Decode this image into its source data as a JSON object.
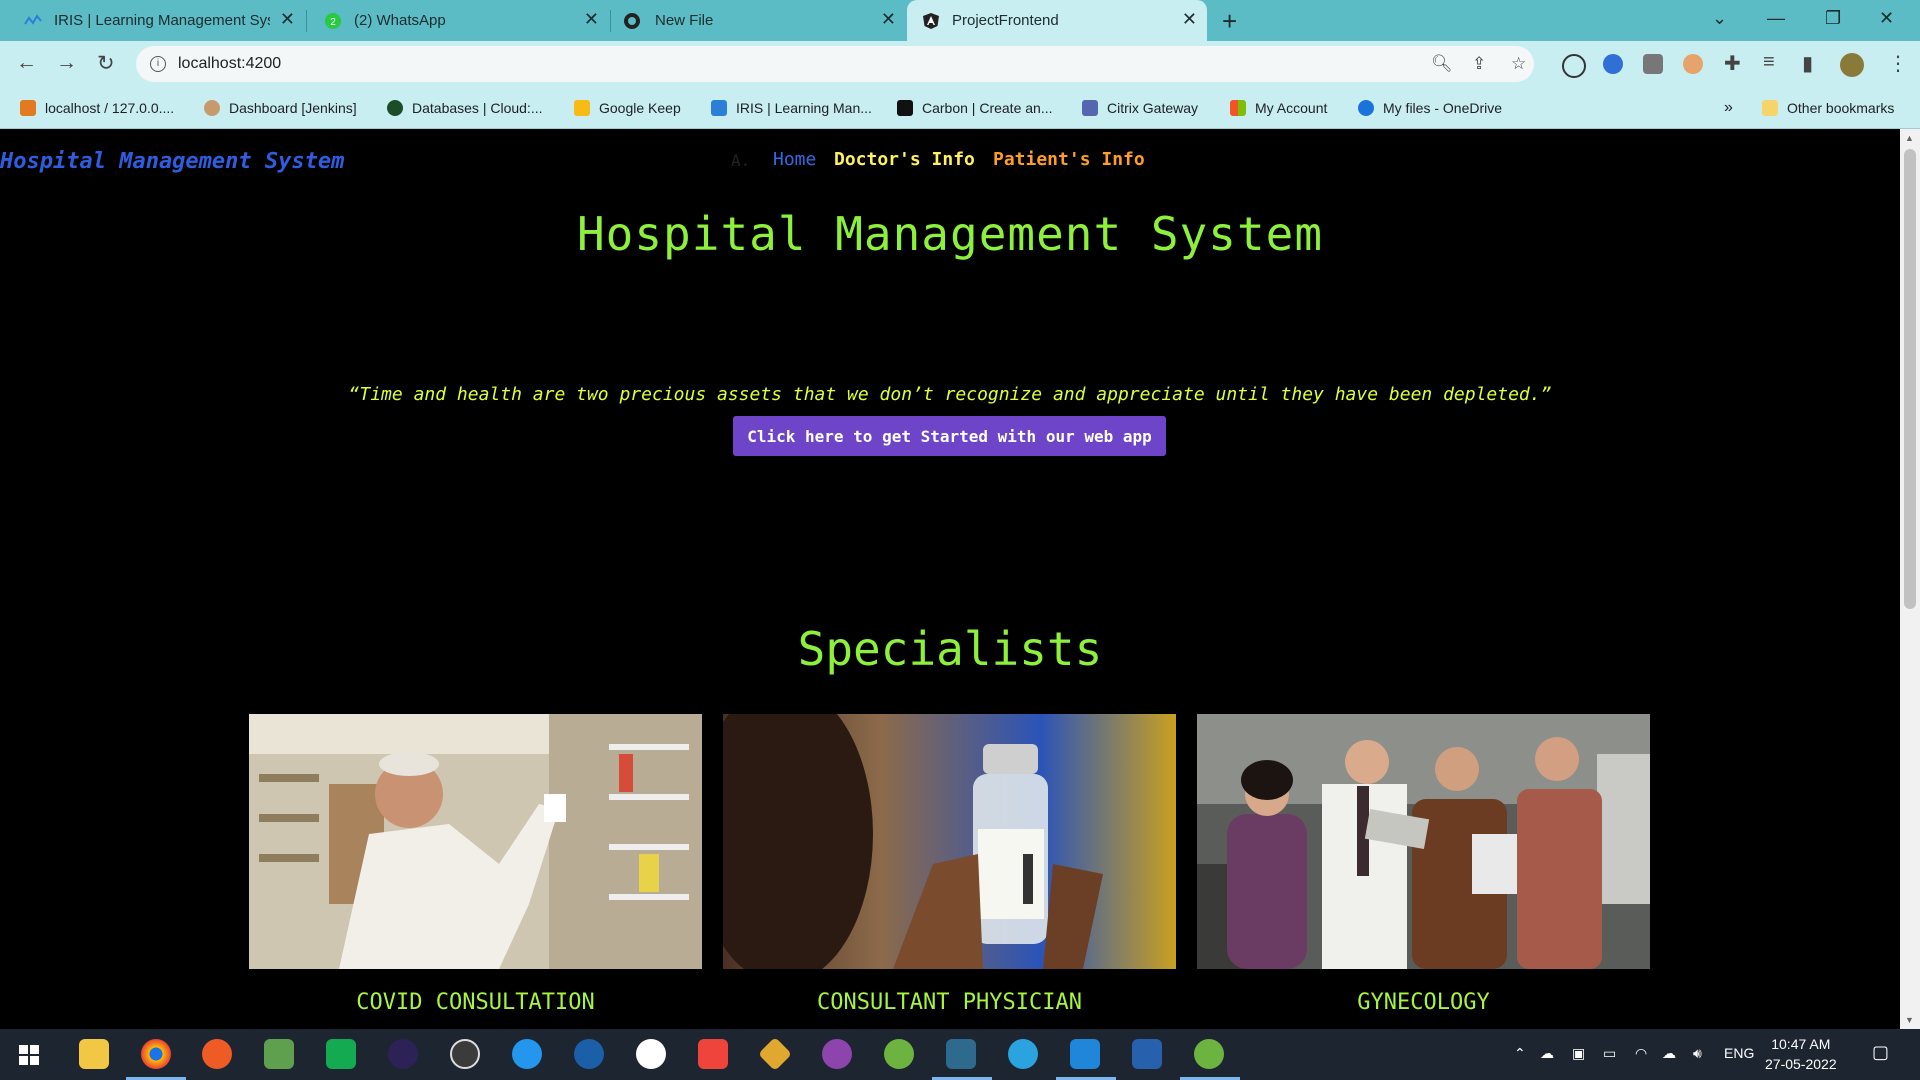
{
  "browser": {
    "tabs": [
      {
        "label": "IRIS | Learning Management Syst",
        "icon": "iris-icon",
        "active": false
      },
      {
        "label": "(2) WhatsApp",
        "icon": "whatsapp-icon",
        "active": false
      },
      {
        "label": "New File",
        "icon": "github-icon",
        "active": false
      },
      {
        "label": "ProjectFrontend",
        "icon": "angular-icon",
        "active": true
      }
    ],
    "new_tab_symbol": "+",
    "close_symbol": "✕",
    "url": "localhost:4200",
    "bookmarks": [
      {
        "label": "localhost / 127.0.0....",
        "icon": "phpmyadmin-icon",
        "color": "#e27b1f"
      },
      {
        "label": "Dashboard [Jenkins]",
        "icon": "jenkins-icon",
        "color": "#c79a6e"
      },
      {
        "label": "Databases | Cloud:...",
        "icon": "mongodb-icon",
        "color": "#1b4d28"
      },
      {
        "label": "Google Keep",
        "icon": "google-keep-icon",
        "color": "#f8bb16"
      },
      {
        "label": "IRIS | Learning Man...",
        "icon": "iris-icon",
        "color": "#2b7fd6"
      },
      {
        "label": "Carbon | Create an...",
        "icon": "carbon-icon",
        "color": "#111111"
      },
      {
        "label": "Citrix Gateway",
        "icon": "lock-icon",
        "color": "#5466b0"
      },
      {
        "label": "My Account",
        "icon": "microsoft-icon",
        "color": "#f35325"
      },
      {
        "label": "My files - OneDrive",
        "icon": "onedrive-icon",
        "color": "#1a73d9"
      }
    ],
    "more_bookmarks": "»",
    "other_bookmarks": "Other bookmarks"
  },
  "page": {
    "brand": "Hospital Management System",
    "nav": {
      "marker": "A.",
      "home": "Home",
      "doctors": "Doctor's Info",
      "patients": "Patient's Info"
    },
    "hero_title": "Hospital Management System",
    "quote": "“Time and health are two precious assets that we don’t recognize and appreciate until they have been depleted.”",
    "cta": "Click here to get Started with our web app",
    "section_title": "Specialists",
    "cards": [
      {
        "caption": "COVID CONSULTATION"
      },
      {
        "caption": "CONSULTANT PHYSICIAN"
      },
      {
        "caption": "GYNECOLOGY"
      }
    ]
  },
  "taskbar": {
    "language": "ENG",
    "time": "10:47 AM",
    "date": "27-05-2022"
  }
}
